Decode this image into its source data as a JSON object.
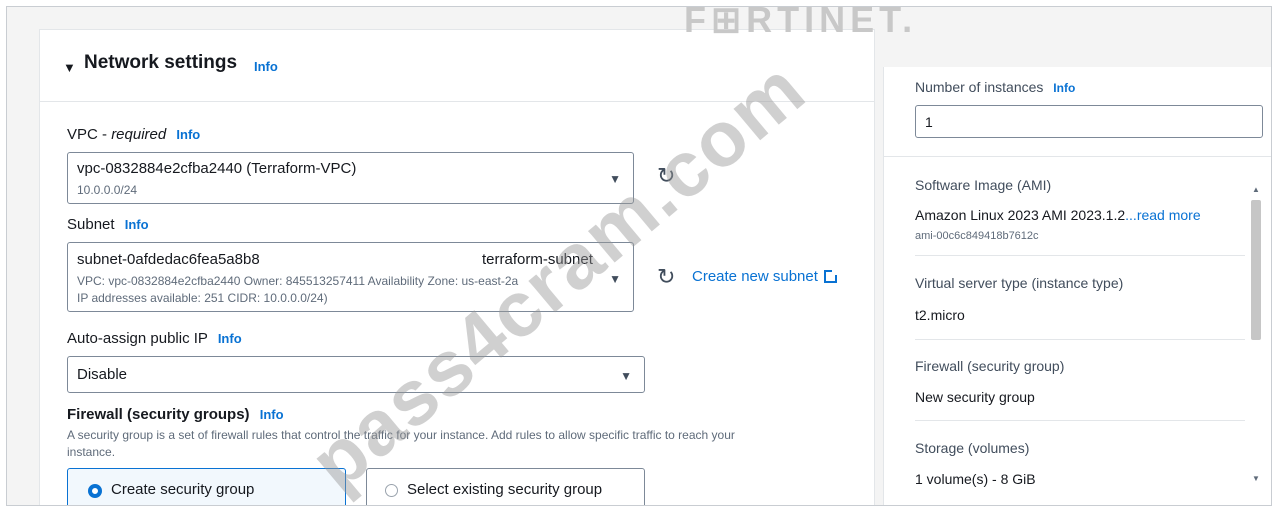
{
  "network_settings": {
    "title": "Network settings",
    "info": "Info",
    "vpc": {
      "label_main": "VPC - ",
      "label_required": "required",
      "info": "Info",
      "value": "vpc-0832884e2cfba2440 (Terraform-VPC)",
      "sub": "10.0.0.0/24"
    },
    "subnet": {
      "label": "Subnet",
      "info": "Info",
      "value": "subnet-0afdedac6fea5a8b8",
      "name": "terraform-subnet",
      "details_line1": "VPC: vpc-0832884e2cfba2440    Owner: 845513257411    Availability Zone: us-east-2a",
      "details_line2": "IP addresses available: 251    CIDR: 10.0.0.0/24)",
      "create_link": "Create new subnet"
    },
    "auto_assign": {
      "label": "Auto-assign public IP",
      "info": "Info",
      "value": "Disable"
    },
    "firewall": {
      "label": "Firewall (security groups)",
      "info": "Info",
      "helper_line1": "A security group is a set of firewall rules that control the traffic for your instance. Add rules to allow specific traffic to reach your",
      "helper_line2": "instance.",
      "option_create": "Create security group",
      "option_existing": "Select existing security group"
    }
  },
  "summary": {
    "instances_label": "Number of instances",
    "instances_info": "Info",
    "instances_value": "1",
    "ami_label": "Software Image (AMI)",
    "ami_value": "Amazon Linux 2023 AMI 2023.1.2",
    "ami_read_more": "...read more",
    "ami_id": "ami-00c6c849418b7612c",
    "instance_type_label": "Virtual server type (instance type)",
    "instance_type_value": "t2.micro",
    "firewall_label": "Firewall (security group)",
    "firewall_value": "New security group",
    "storage_label": "Storage (volumes)",
    "storage_value": "1 volume(s) - 8 GiB"
  },
  "watermarks": {
    "brand": "F⊞RTINET.",
    "diagonal": "pass4cram.com"
  },
  "colors": {
    "link": "#0972d3",
    "selected_tile_bg": "#f2f8fd",
    "border": "#7d8998"
  },
  "icons": [
    "caret-down-icon",
    "dropdown-arrow-icon",
    "refresh-icon",
    "external-link-icon",
    "radio-selected-icon",
    "radio-unselected-icon",
    "scroll-up-icon",
    "scroll-down-icon"
  ]
}
